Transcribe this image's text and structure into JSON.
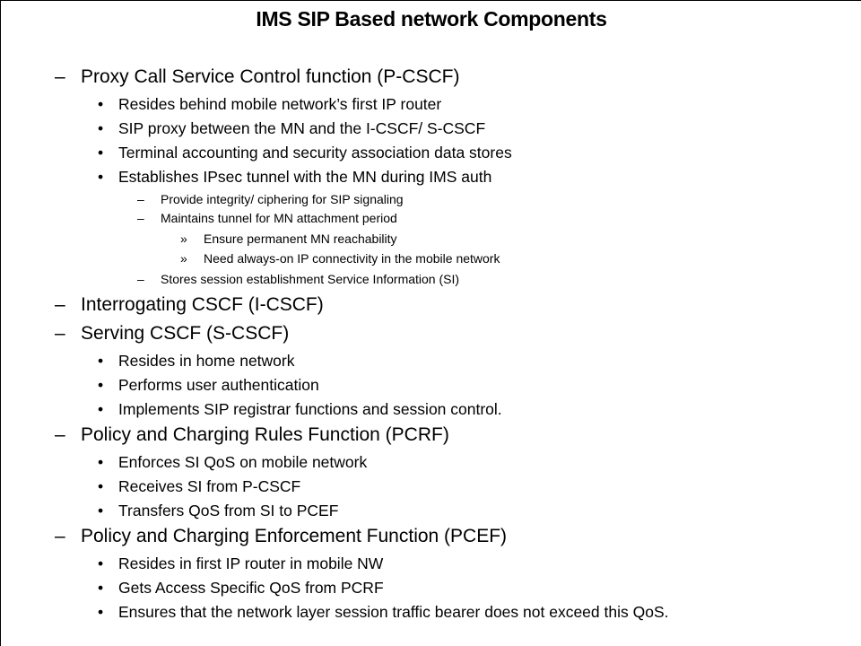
{
  "slide": {
    "title": "IMS SIP Based network Components",
    "markers": {
      "dash": "–",
      "bullet": "•",
      "chevron": "»"
    },
    "items": [
      {
        "level": 1,
        "marker": "–",
        "text": "Proxy Call Service Control function (P-CSCF)"
      },
      {
        "level": 2,
        "marker": "•",
        "text": "Resides behind mobile network’s  first IP router"
      },
      {
        "level": 2,
        "marker": "•",
        "text": "SIP proxy between the MN and the I-CSCF/ S-CSCF"
      },
      {
        "level": 2,
        "marker": "•",
        "text": "Terminal accounting and security association data stores"
      },
      {
        "level": 2,
        "marker": "•",
        "text": "Establishes IPsec tunnel with the MN during IMS auth"
      },
      {
        "level": 3,
        "marker": "–",
        "text": "Provide integrity/ ciphering for SIP signaling"
      },
      {
        "level": 3,
        "marker": "–",
        "text": "Maintains tunnel for MN attachment period"
      },
      {
        "level": 4,
        "marker": "»",
        "text": "Ensure permanent MN reachability"
      },
      {
        "level": 4,
        "marker": "»",
        "text": "Need always-on IP connectivity in the mobile network"
      },
      {
        "level": 3,
        "marker": "–",
        "text": "Stores session establishment Service Information (SI)"
      },
      {
        "level": 1,
        "marker": "–",
        "text": "Interrogating CSCF (I-CSCF)"
      },
      {
        "level": 1,
        "marker": "–",
        "text": "Serving CSCF (S-CSCF)"
      },
      {
        "level": 2,
        "marker": "•",
        "text": "Resides in home network"
      },
      {
        "level": 2,
        "marker": "•",
        "text": "Performs user authentication"
      },
      {
        "level": 2,
        "marker": "•",
        "text": "Implements  SIP registrar functions and session control."
      },
      {
        "level": 1,
        "marker": "–",
        "text": "Policy and Charging Rules Function (PCRF)"
      },
      {
        "level": 2,
        "marker": "•",
        "text": "Enforces SI QoS on mobile network"
      },
      {
        "level": 2,
        "marker": "•",
        "text": "Receives SI from P-CSCF"
      },
      {
        "level": 2,
        "marker": "•",
        "text": "Transfers QoS from SI to PCEF"
      },
      {
        "level": 1,
        "marker": "–",
        "text": "Policy and Charging Enforcement Function (PCEF)"
      },
      {
        "level": 2,
        "marker": "•",
        "text": "Resides in first IP router in mobile NW"
      },
      {
        "level": 2,
        "marker": "•",
        "text": "Gets Access Specific QoS from PCRF"
      },
      {
        "level": 2,
        "marker": "•",
        "text": "Ensures that the network layer session traffic bearer does not exceed this QoS."
      }
    ]
  }
}
